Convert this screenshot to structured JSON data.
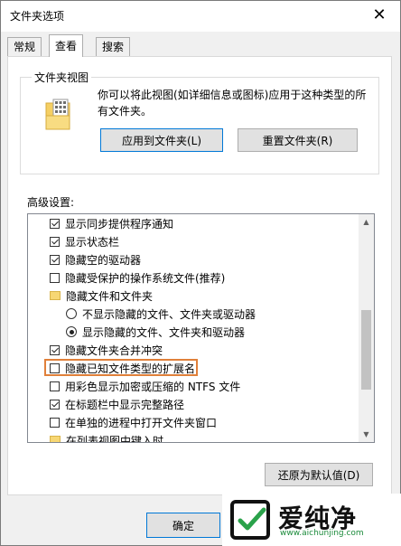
{
  "window": {
    "title": "文件夹选项",
    "close_glyph": "✕"
  },
  "tabs": [
    {
      "label": "常规"
    },
    {
      "label": "查看"
    },
    {
      "label": "搜索"
    }
  ],
  "folder_views": {
    "legend": "文件夹视图",
    "description": "你可以将此视图(如详细信息或图标)应用于这种类型的所有文件夹。",
    "apply_button": "应用到文件夹(L)",
    "reset_button": "重置文件夹(R)"
  },
  "advanced": {
    "label": "高级设置:",
    "items": [
      {
        "type": "checkbox",
        "checked": true,
        "label": "显示同步提供程序通知"
      },
      {
        "type": "checkbox",
        "checked": true,
        "label": "显示状态栏"
      },
      {
        "type": "checkbox",
        "checked": true,
        "label": "隐藏空的驱动器"
      },
      {
        "type": "checkbox",
        "checked": false,
        "label": "隐藏受保护的操作系统文件(推荐)"
      },
      {
        "type": "folder",
        "label": "隐藏文件和文件夹"
      },
      {
        "type": "radio",
        "checked": false,
        "label": "不显示隐藏的文件、文件夹或驱动器"
      },
      {
        "type": "radio",
        "checked": true,
        "label": "显示隐藏的文件、文件夹和驱动器"
      },
      {
        "type": "checkbox",
        "checked": true,
        "label": "隐藏文件夹合并冲突"
      },
      {
        "type": "checkbox",
        "checked": false,
        "label": "隐藏已知文件类型的扩展名"
      },
      {
        "type": "checkbox",
        "checked": false,
        "label": "用彩色显示加密或压缩的 NTFS 文件"
      },
      {
        "type": "checkbox",
        "checked": true,
        "label": "在标题栏中显示完整路径"
      },
      {
        "type": "checkbox",
        "checked": false,
        "label": "在单独的进程中打开文件夹窗口"
      },
      {
        "type": "folder",
        "label": "在列表视图中键入时"
      }
    ]
  },
  "restore_button": "还原为默认值(D)",
  "ok_button": "确定",
  "watermark": {
    "text": "爱纯净",
    "url": "www.aichunjing.com"
  },
  "colors": {
    "highlight": "#e0803a",
    "accent": "#0078d7",
    "watermark_green": "#1a8a3a"
  }
}
